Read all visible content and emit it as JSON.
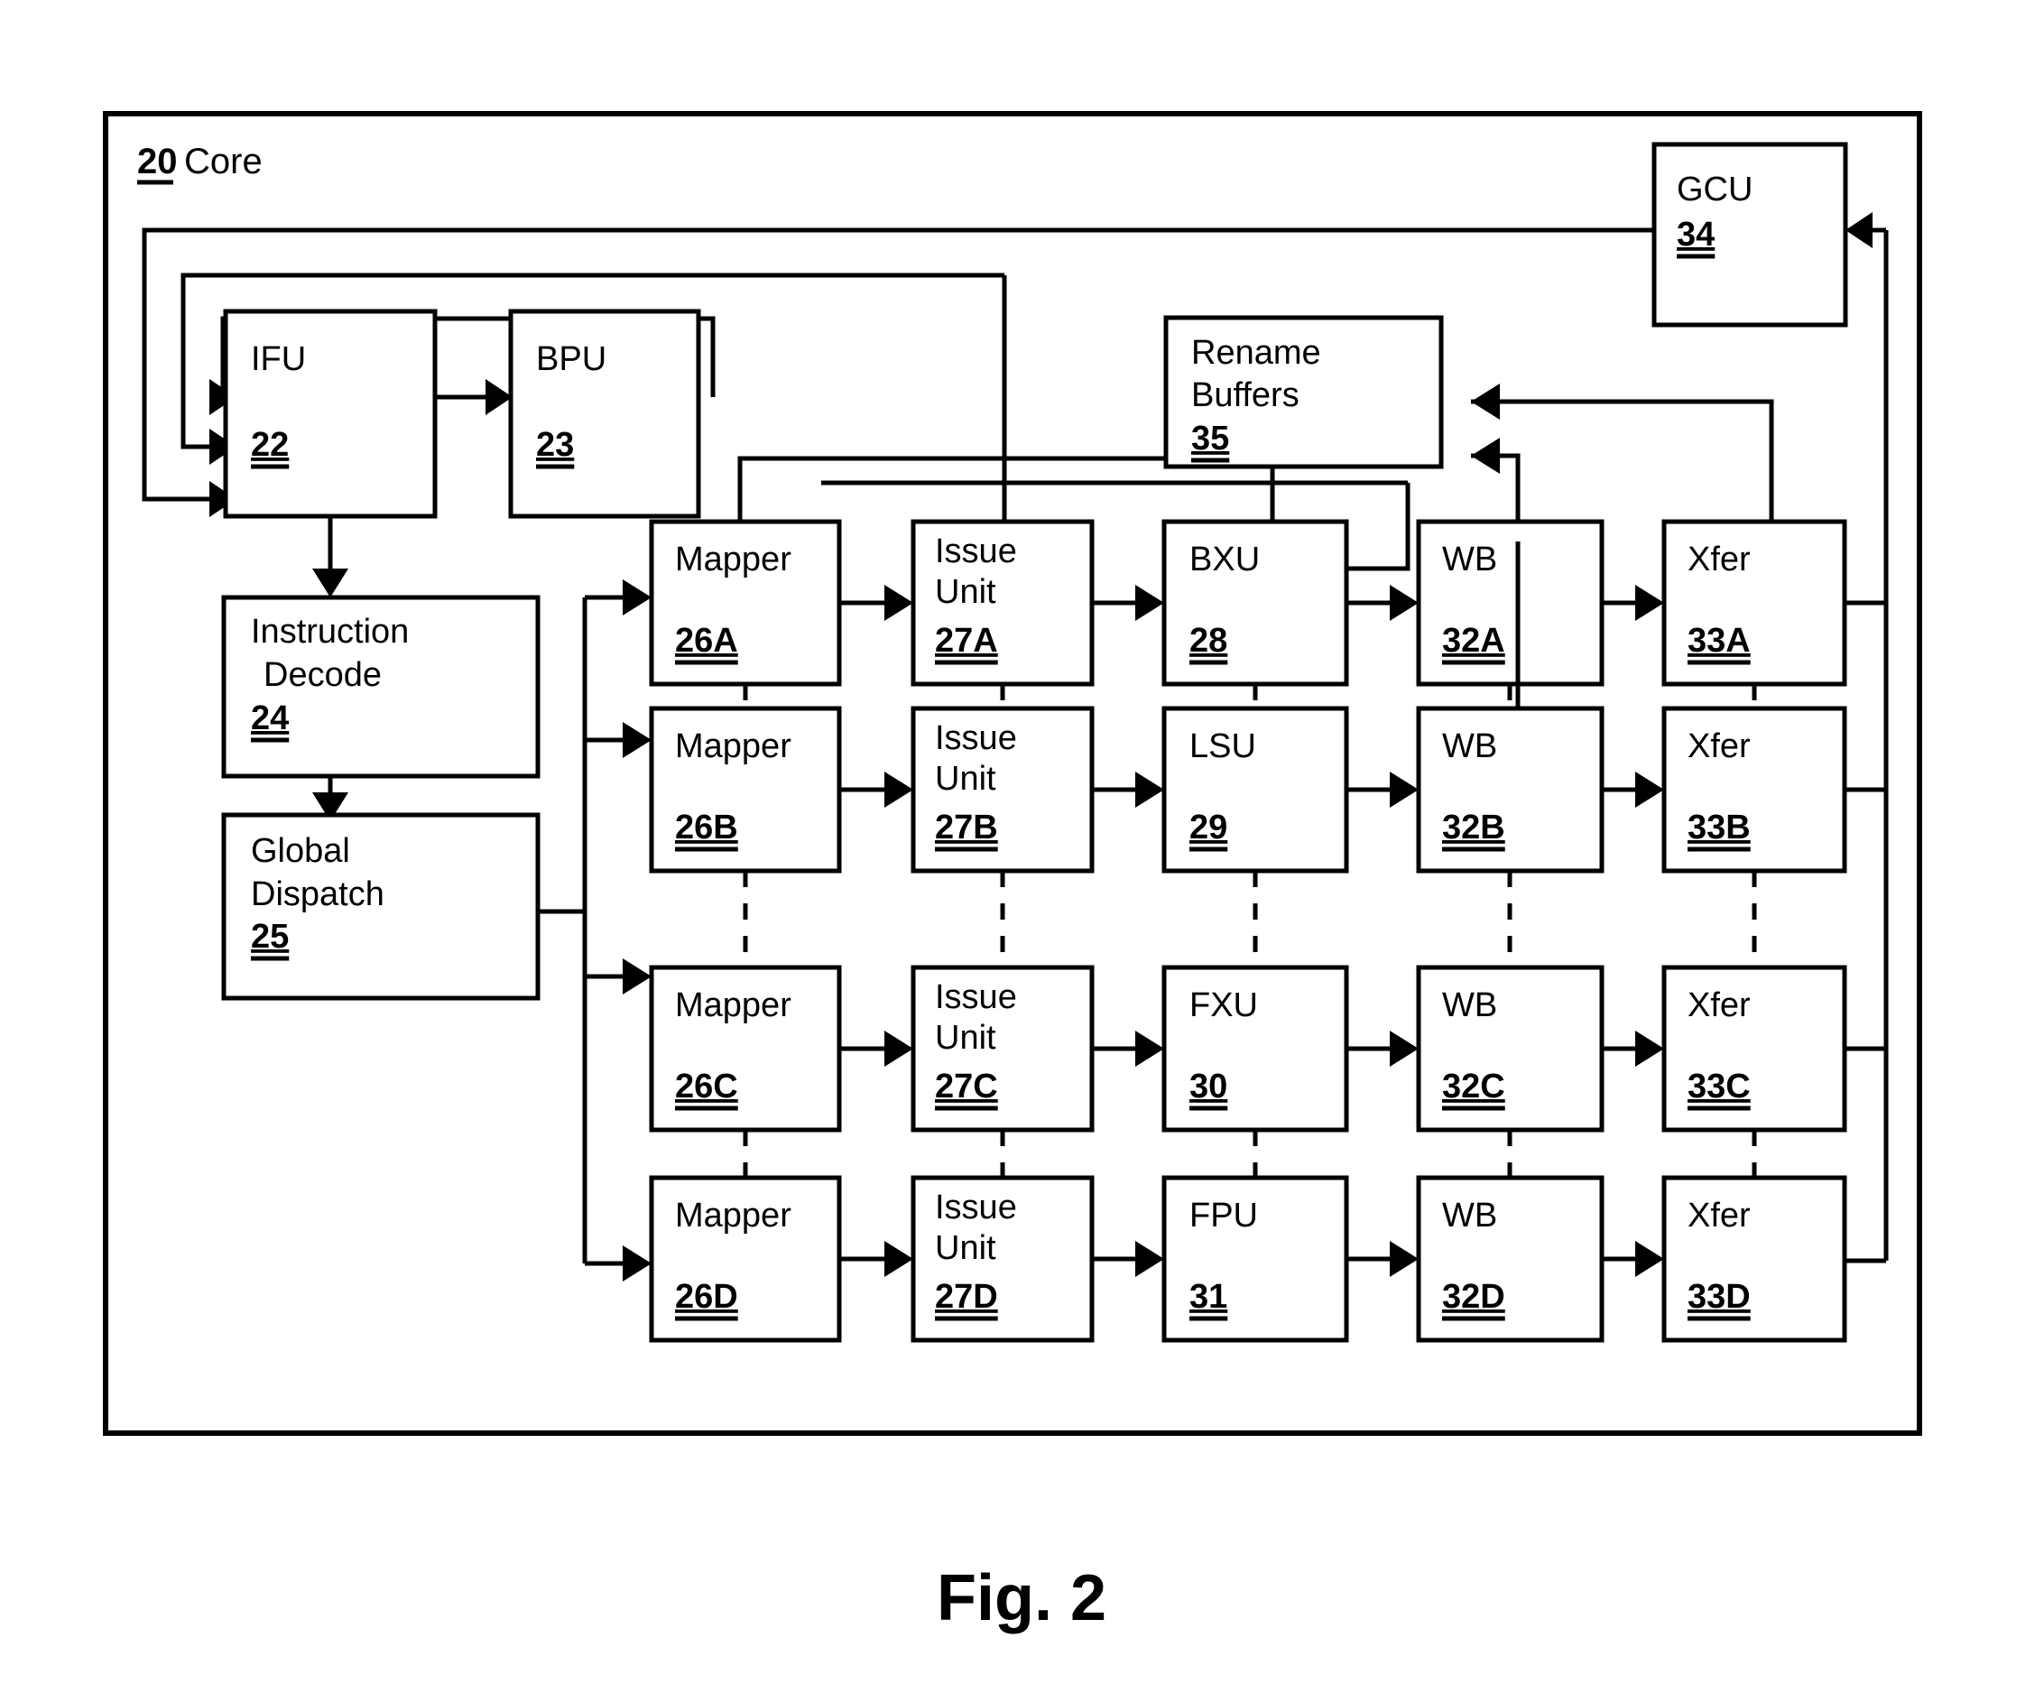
{
  "figure": {
    "caption": "Fig. 2",
    "core_ref": "20",
    "core_title": "Core"
  },
  "blocks": {
    "ifu": {
      "label": "IFU",
      "ref": "22"
    },
    "bpu": {
      "label": "BPU",
      "ref": "23"
    },
    "decode": {
      "label_line1": "Instruction",
      "label_line2": "Decode",
      "ref": "24"
    },
    "dispatch": {
      "label_line1": "Global",
      "label_line2": "Dispatch",
      "ref": "25"
    },
    "gcu": {
      "label": "GCU",
      "ref": "34"
    },
    "rename": {
      "label_line1": "Rename",
      "label_line2": "Buffers",
      "ref": "35"
    },
    "mapper_a": {
      "label": "Mapper",
      "ref": "26A"
    },
    "mapper_b": {
      "label": "Mapper",
      "ref": "26B"
    },
    "mapper_c": {
      "label": "Mapper",
      "ref": "26C"
    },
    "mapper_d": {
      "label": "Mapper",
      "ref": "26D"
    },
    "issue_a": {
      "label_line1": "Issue",
      "label_line2": "Unit",
      "ref": "27A"
    },
    "issue_b": {
      "label_line1": "Issue",
      "label_line2": "Unit",
      "ref": "27B"
    },
    "issue_c": {
      "label_line1": "Issue",
      "label_line2": "Unit",
      "ref": "27C"
    },
    "issue_d": {
      "label_line1": "Issue",
      "label_line2": "Unit",
      "ref": "27D"
    },
    "bxu": {
      "label": "BXU",
      "ref": "28"
    },
    "lsu": {
      "label": "LSU",
      "ref": "29"
    },
    "fxu": {
      "label": "FXU",
      "ref": "30"
    },
    "fpu": {
      "label": "FPU",
      "ref": "31"
    },
    "wb_a": {
      "label": "WB",
      "ref": "32A"
    },
    "wb_b": {
      "label": "WB",
      "ref": "32B"
    },
    "wb_c": {
      "label": "WB",
      "ref": "32C"
    },
    "wb_d": {
      "label": "WB",
      "ref": "32D"
    },
    "xfer_a": {
      "label": "Xfer",
      "ref": "33A"
    },
    "xfer_b": {
      "label": "Xfer",
      "ref": "33B"
    },
    "xfer_c": {
      "label": "Xfer",
      "ref": "33C"
    },
    "xfer_d": {
      "label": "Xfer",
      "ref": "33D"
    }
  },
  "colors": {
    "stroke": "#000000",
    "fill": "#ffffff",
    "background": "#ffffff"
  }
}
